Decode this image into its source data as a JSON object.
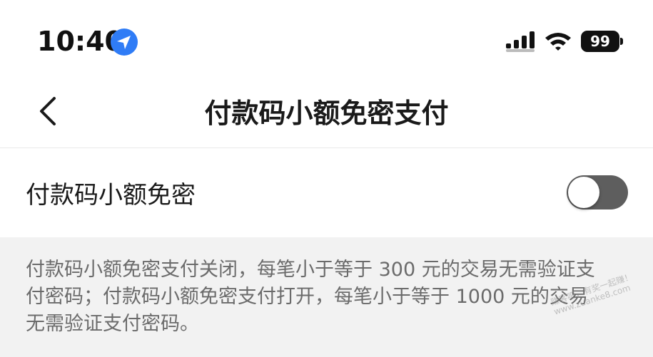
{
  "status_bar": {
    "time": "10:40",
    "battery": "99",
    "icons": [
      "location-arrow-icon",
      "cellular-signal-icon",
      "wifi-icon",
      "battery-icon"
    ]
  },
  "nav": {
    "title": "付款码小额免密支付",
    "back_icon": "chevron-left-icon"
  },
  "setting": {
    "label": "付款码小额免密",
    "toggle_on": false
  },
  "description": {
    "line1": "付款码小额免密支付关闭，每笔小于等于 300 元的交易无需验证支",
    "line2": "付密码；付款码小额免密支付打开，每笔小于等于 1000 元的交易",
    "line3": "无需验证支付密码。"
  },
  "watermark": {
    "line1": "赚客吧，有奖一起赚！",
    "line2": "www.zuanke8.com"
  },
  "colors": {
    "location_blue": "#2f7cf6",
    "toggle_off": "#5e5e5e",
    "background_gray": "#f2f2f2"
  }
}
